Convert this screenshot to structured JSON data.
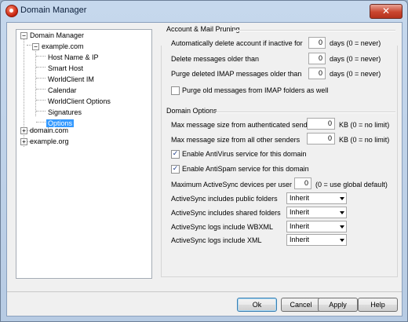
{
  "window": {
    "title": "Domain Manager",
    "close_glyph": "✕",
    "icon": "mdaemon-app-icon"
  },
  "tree": {
    "root": "Domain Manager",
    "domains": [
      {
        "label": "example.com",
        "expanded": true,
        "toggle": "−",
        "children": [
          "Host Name & IP",
          "Smart Host",
          "WorldClient IM",
          "Calendar",
          "WorldClient Options",
          "Signatures",
          "Options"
        ]
      },
      {
        "label": "domain.com",
        "expanded": false,
        "toggle": "+"
      },
      {
        "label": "example.org",
        "expanded": false,
        "toggle": "+"
      }
    ],
    "root_toggle": "−",
    "selected": "Options"
  },
  "pruning": {
    "title": "Account & Mail Pruning",
    "rows": [
      {
        "label": "Automatically delete account if inactive for",
        "value": "0",
        "unit": "days (0 = never)"
      },
      {
        "label": "Delete messages older than",
        "value": "0",
        "unit": "days (0 = never)"
      },
      {
        "label": "Purge deleted IMAP messages older than",
        "value": "0",
        "unit": "days (0 = never)"
      }
    ],
    "purge_imap": {
      "label": "Purge old messages from IMAP folders as well",
      "checked": false
    }
  },
  "options": {
    "title": "Domain Options",
    "size_rows": [
      {
        "label": "Max message size from authenticated senders",
        "value": "0",
        "unit": "KB (0 = no limit)"
      },
      {
        "label": "Max message size from all other senders",
        "value": "0",
        "unit": "KB (0 = no limit)"
      }
    ],
    "antivirus": {
      "label": "Enable AntiVirus service for this domain",
      "checked": true
    },
    "antispam": {
      "label": "Enable AntiSpam service for this domain",
      "checked": true
    },
    "max_devices": {
      "label": "Maximum ActiveSync devices per user",
      "value": "0",
      "unit": "(0 = use global default)"
    },
    "selects": [
      {
        "label": "ActiveSync includes public folders",
        "value": "Inherit"
      },
      {
        "label": "ActiveSync includes shared folders",
        "value": "Inherit"
      },
      {
        "label": "ActiveSync logs include WBXML",
        "value": "Inherit"
      },
      {
        "label": "ActiveSync logs include XML",
        "value": "Inherit"
      }
    ],
    "check_glyph": "✓"
  },
  "buttons": {
    "ok": "Ok",
    "cancel": "Cancel",
    "apply": "Apply",
    "help": "Help"
  }
}
